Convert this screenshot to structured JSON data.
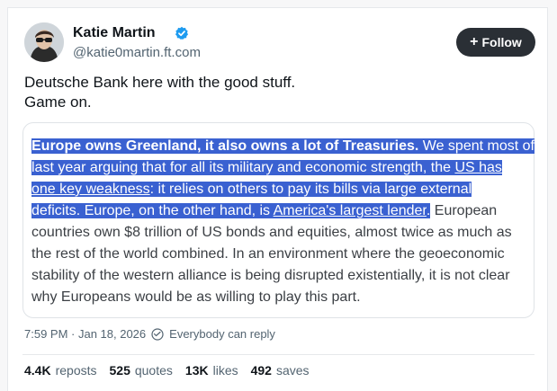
{
  "author": {
    "name": "Katie Martin",
    "handle": "@katie0martin.ft.com",
    "verified_color": "#1d9bf0",
    "avatar_icon": "avatar-photo"
  },
  "follow_button": {
    "label": "Follow",
    "icon": "plus-icon"
  },
  "tweet": {
    "lines": [
      "Deutsche Bank here with the good stuff.",
      "Game on."
    ]
  },
  "quote": {
    "l1_bold": "Europe owns Greenland, it also owns a lot of Treasuries.",
    "l1_rest": " We spent most of",
    "l2_a": "last year arguing that for all its military and economic strength, the ",
    "l2_link": "US has",
    "l3_link": "one key weakness",
    "l3_rest": ": it relies on others to pay its bills via large external",
    "l4_a": "deficits. Europe, on the other hand, is ",
    "l4_link": "America's largest lender",
    "l4_hl_end": ".",
    "l4_rest": " European",
    "l5": "countries own $8 trillion of US bonds and equities, almost twice as much as",
    "l6": "the rest of the world combined. In an environment where the geoeconomic",
    "l7": "stability of the western alliance is being disrupted existentially, it is not clear",
    "l8": "why Europeans would be as willing to play this part.",
    "highlight_color": "#3a61d1"
  },
  "meta": {
    "timestamp": "7:59 PM · Jan 18, 2026",
    "reply_setting": "Everybody can reply",
    "reply_icon": "globe-icon"
  },
  "stats": {
    "reposts_count": "4.4K",
    "reposts_label": "reposts",
    "quotes_count": "525",
    "quotes_label": "quotes",
    "likes_count": "13K",
    "likes_label": "likes",
    "saves_count": "492",
    "saves_label": "saves"
  }
}
